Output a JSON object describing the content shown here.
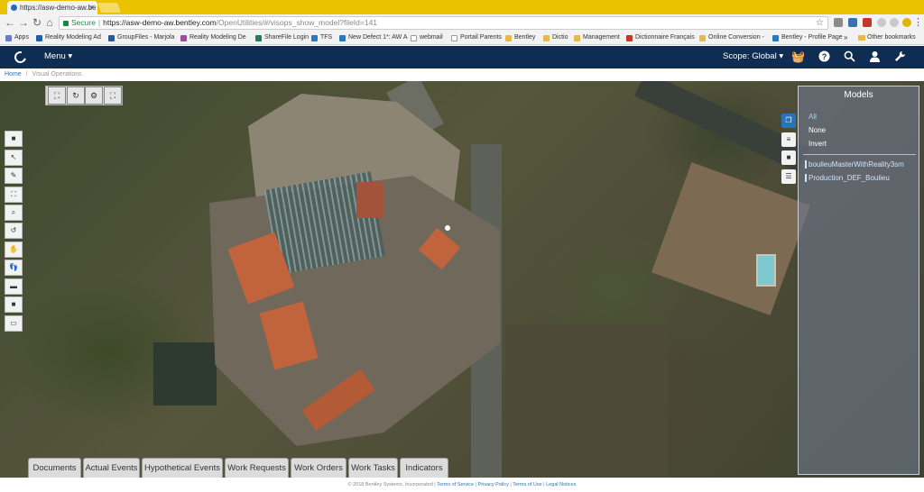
{
  "browser": {
    "tab_title": "https://asw-demo-aw.be",
    "tab_close": "×",
    "secure_label": "Secure",
    "url_host": "https://asw-demo-aw.bentley.com",
    "url_path": "/OpenUtilities/#/visops_show_model?fileId=141",
    "bookmarks": [
      {
        "label": "Apps",
        "color": "#6b7bd1"
      },
      {
        "label": "Reality Modeling Ad",
        "color": "#1f5fa8"
      },
      {
        "label": "GroupFiles - Marjola",
        "color": "#2b5797"
      },
      {
        "label": "Reality Modeling De",
        "color": "#9b4f96"
      },
      {
        "label": "ShareFile Login",
        "color": "#1e7f5c"
      },
      {
        "label": "TFS",
        "color": "#2b78c2"
      },
      {
        "label": "New Defect 1*: AW A",
        "color": "#2b78c2"
      },
      {
        "label": "webmail",
        "color": "#444444"
      },
      {
        "label": "Portail Parents",
        "color": "#444444"
      },
      {
        "label": "Bentley",
        "color": "#e5b94a"
      },
      {
        "label": "Dictio",
        "color": "#e5b94a"
      },
      {
        "label": "Management",
        "color": "#e5b94a"
      },
      {
        "label": "Dictionnaire Français",
        "color": "#c0392b"
      },
      {
        "label": "Online Conversion -",
        "color": "#e5b94a"
      },
      {
        "label": "Bentley - Profile Page",
        "color": "#2b78c2"
      }
    ],
    "more_bookmarks": "»",
    "other_bookmarks": "Other bookmarks"
  },
  "header": {
    "menu_label": "Menu ▾",
    "scope_label": "Scope: Global ▾"
  },
  "breadcrumb": {
    "home": "Home",
    "separator": "/",
    "current": "Visual Operations"
  },
  "models_panel": {
    "title": "Models",
    "select_all": "All",
    "select_none": "None",
    "invert": "Invert",
    "items": [
      "boulieuMasterWithReality3sm",
      "Production_DEF_Boulieu"
    ]
  },
  "bottom_tabs": [
    "Documents",
    "Actual Events",
    "Hypothetical Events",
    "Work Requests",
    "Work Orders",
    "Work Tasks",
    "Indicators"
  ],
  "footer": {
    "copyright": "© 2018 Bentley Systems, Incorporated",
    "terms": "Terms of Service",
    "privacy": "Privacy Policy",
    "terms_use": "Terms of Use",
    "legal": "Legal Notices"
  },
  "colors": {
    "tab_strip": "#e9c200",
    "app_bar": "#0f2d52",
    "accent": "#2a73b8"
  }
}
